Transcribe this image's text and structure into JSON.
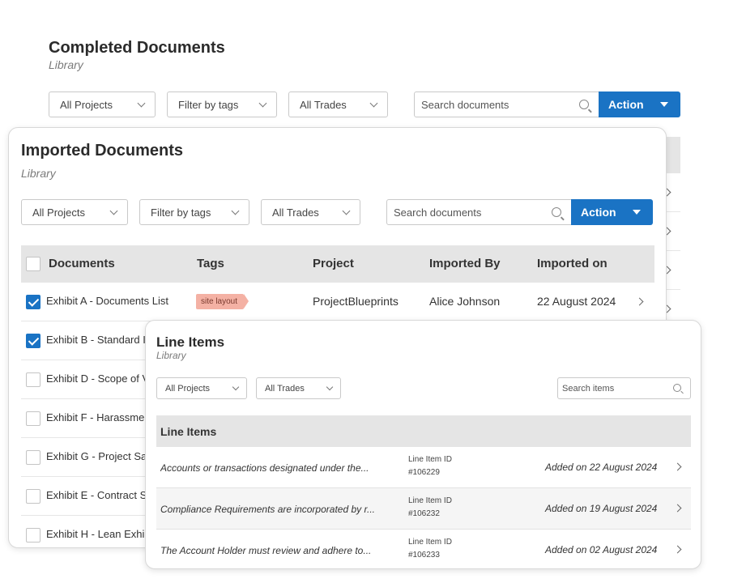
{
  "back_panel": {
    "title": "Completed Documents",
    "subtitle": "Library",
    "filters": {
      "projects": "All Projects",
      "tags": "Filter by tags",
      "trades": "All Trades"
    },
    "search_placeholder": "Search documents",
    "action_label": "Action"
  },
  "imported_panel": {
    "title": "Imported Documents",
    "subtitle": "Library",
    "filters": {
      "projects": "All Projects",
      "tags": "Filter by tags",
      "trades": "All Trades"
    },
    "search_placeholder": "Search documents",
    "action_label": "Action",
    "columns": {
      "documents": "Documents",
      "tags": "Tags",
      "project": "Project",
      "imported_by": "Imported By",
      "imported_on": "Imported on"
    },
    "rows": [
      {
        "name": "Exhibit A - Documents List",
        "checked": true,
        "tag": "site layout",
        "project": "ProjectBlueprints",
        "imported_by": "Alice Johnson",
        "imported_on": "22 August 2024"
      },
      {
        "name": "Exhibit B - Standard I",
        "checked": true
      },
      {
        "name": "Exhibit D - Scope of V",
        "checked": false
      },
      {
        "name": "Exhibit F - Harassme",
        "checked": false
      },
      {
        "name": "Exhibit G - Project Sa",
        "checked": false
      },
      {
        "name": "Exhibit E - Contract S",
        "checked": false
      },
      {
        "name": "Exhibit H - Lean Exhil",
        "checked": false
      }
    ]
  },
  "line_items_panel": {
    "title": "Line Items",
    "subtitle": "Library",
    "filters": {
      "projects": "All Projects",
      "trades": "All Trades"
    },
    "search_placeholder": "Search items",
    "table_header": "Line Items",
    "items": [
      {
        "description": "Accounts or transactions designated under the...",
        "id_label": "Line Item ID",
        "id": "#106229",
        "added": "Added on 22 August 2024"
      },
      {
        "description": "Compliance Requirements are incorporated by r...",
        "id_label": "Line Item ID",
        "id": "#106232",
        "added": "Added on 19 August 2024"
      },
      {
        "description": "The Account Holder must review and adhere to...",
        "id_label": "Line Item ID",
        "id": "#106233",
        "added": "Added on 02 August 2024"
      }
    ]
  },
  "colors": {
    "accent": "#1a73c4",
    "tag_bg": "#f4b1a4",
    "header_bg": "#e5e5e5"
  }
}
